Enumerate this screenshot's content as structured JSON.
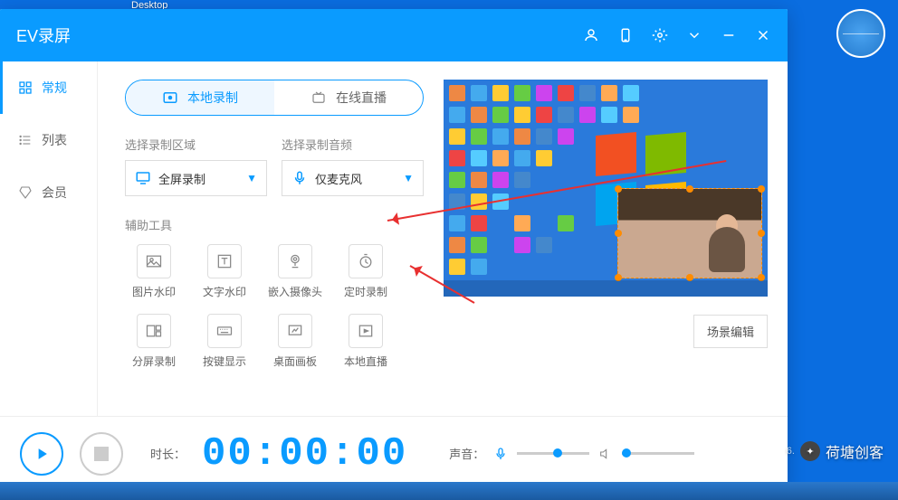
{
  "desktop": {
    "shortcut_label": "Desktop"
  },
  "app": {
    "title": "EV录屏",
    "sidebar": [
      {
        "key": "normal",
        "label": "常规",
        "active": true
      },
      {
        "key": "list",
        "label": "列表",
        "active": false
      },
      {
        "key": "member",
        "label": "会员",
        "active": false
      }
    ],
    "tabs": [
      {
        "key": "local",
        "label": "本地录制",
        "active": true
      },
      {
        "key": "live",
        "label": "在线直播",
        "active": false
      }
    ],
    "section_area_label": "选择录制区域",
    "section_audio_label": "选择录制音频",
    "select_area": "全屏录制",
    "select_audio": "仅麦克风",
    "aux_label": "辅助工具",
    "tools": [
      {
        "key": "img-wm",
        "label": "图片水印"
      },
      {
        "key": "text-wm",
        "label": "文字水印"
      },
      {
        "key": "camera",
        "label": "嵌入摄像头"
      },
      {
        "key": "timer",
        "label": "定时录制"
      },
      {
        "key": "split",
        "label": "分屏录制"
      },
      {
        "key": "keys",
        "label": "按键显示"
      },
      {
        "key": "board",
        "label": "桌面画板"
      },
      {
        "key": "localcast",
        "label": "本地直播"
      }
    ],
    "scene_edit": "场景编辑",
    "duration_label": "时长：",
    "duration_value": "00:00:00",
    "volume_label": "声音："
  },
  "watermark": {
    "text": "荷塘创客",
    "version": "6."
  }
}
